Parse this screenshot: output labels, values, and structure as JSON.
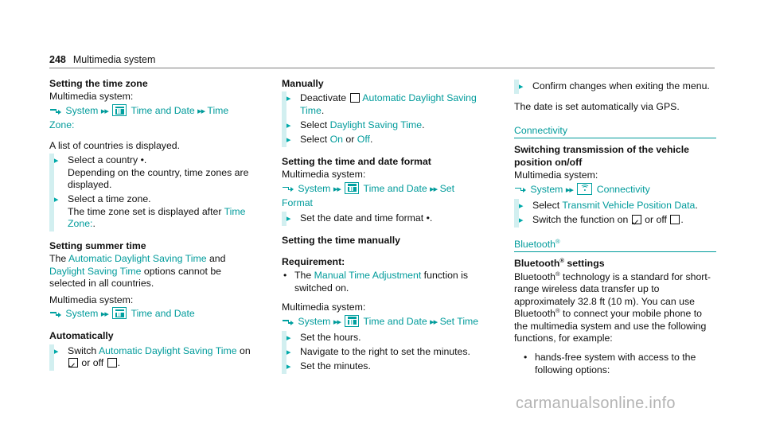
{
  "header": {
    "page_number": "248",
    "chapter_title": "Multimedia system"
  },
  "glyphs": {
    "seq_arrow": "sequence-arrow-icon",
    "double_arrow": "▸▸",
    "step_arrow": "▶",
    "dot_bullet": "•",
    "calendar_icon": "calendar-icon",
    "connectivity_icon": "wifi-icon"
  },
  "columns": {
    "left": {
      "time_zone": {
        "heading": "Setting the time zone",
        "intro": "Multimedia system:",
        "path": {
          "item1": "System",
          "item2": "Time and Date",
          "item3": "Time Zone:"
        },
        "note": "A list of countries is displayed.",
        "steps": [
          {
            "text_a": "Select a country ",
            "text_b": ".",
            "sub": "Depending on the country, time zones are displayed."
          },
          {
            "text_a": "Select a time zone.",
            "sub_a": "The time zone set is displayed after ",
            "sub_link": "Time Zone:",
            "sub_b": "."
          }
        ]
      },
      "summer_time": {
        "heading": "Setting summer time",
        "para_a": "The ",
        "link_a": "Automatic Daylight Saving Time",
        "para_b": " and ",
        "link_b": "Daylight Saving Time",
        "para_c": " options cannot be selected in all countries.",
        "intro": "Multimedia system:",
        "path": {
          "item1": "System",
          "item2": "Time and Date"
        }
      },
      "automatically": {
        "heading": "Automatically",
        "step_a": "Switch ",
        "step_link": "Automatic Daylight Saving Time",
        "step_b": " on ",
        "step_c": " or off ",
        "step_d": "."
      }
    },
    "middle": {
      "manually": {
        "heading": "Manually",
        "step1_a": "Deactivate ",
        "step1_link": "Automatic Daylight Saving Time",
        "step1_b": ".",
        "step2_a": "Select ",
        "step2_link": "Daylight Saving Time",
        "step2_b": ".",
        "step3_a": "Select ",
        "step3_link_on": "On",
        "step3_mid": " or ",
        "step3_link_off": "Off",
        "step3_b": "."
      },
      "date_format": {
        "heading": "Setting the time and date format",
        "intro": "Multimedia system:",
        "path": {
          "item1": "System",
          "item2": "Time and Date",
          "item3": "Set Format"
        },
        "step_a": "Set the date and time format ",
        "step_b": "."
      },
      "time_manually": {
        "heading": "Setting the time manually",
        "requirement_label": "Requirement:",
        "req_a": "The ",
        "req_link": "Manual Time Adjustment",
        "req_b": " function is switched on.",
        "intro": "Multimedia system:",
        "path": {
          "item1": "System",
          "item2": "Time and Date",
          "item3": "Set Time"
        },
        "steps": [
          "Set the hours.",
          "Navigate to the right to set the minutes.",
          "Set the minutes."
        ]
      }
    },
    "right": {
      "confirm_step": "Confirm changes when exiting the menu.",
      "gps_note": "The date is set automatically via GPS.",
      "connectivity": {
        "section_title": "Connectivity",
        "heading": "Switching transmission of the vehicle position on/off",
        "intro": "Multimedia system:",
        "path": {
          "item1": "System",
          "item2": "Connectivity"
        },
        "step1_a": "Select ",
        "step1_link": "Transmit Vehicle Position Data",
        "step1_b": ".",
        "step2_a": "Switch the function on ",
        "step2_b": " or off ",
        "step2_c": "."
      },
      "bluetooth": {
        "section_title": "Bluetooth",
        "section_title_sup": "®",
        "heading_a": "Bluetooth",
        "heading_sup": "®",
        "heading_b": " settings",
        "body_a": "Bluetooth",
        "body_sup1": "®",
        "body_b": " technology is a standard for short-range wireless data transfer up to approximately 32.8 ft (10 m). You can use Bluetooth",
        "body_sup2": "®",
        "body_c": " to connect your mobile phone to the multimedia system and use the following functions, for example:",
        "bullet1": "hands-free system with access to the following options:"
      }
    }
  },
  "watermark": "carmanualsonline.info",
  "colors": {
    "teal": "#009b9b",
    "teal_icon": "#00a0a0",
    "step_bar": "#d2eff0",
    "text": "#111111",
    "rule": "#7d7d7d",
    "watermark": "#b4b4b4"
  }
}
